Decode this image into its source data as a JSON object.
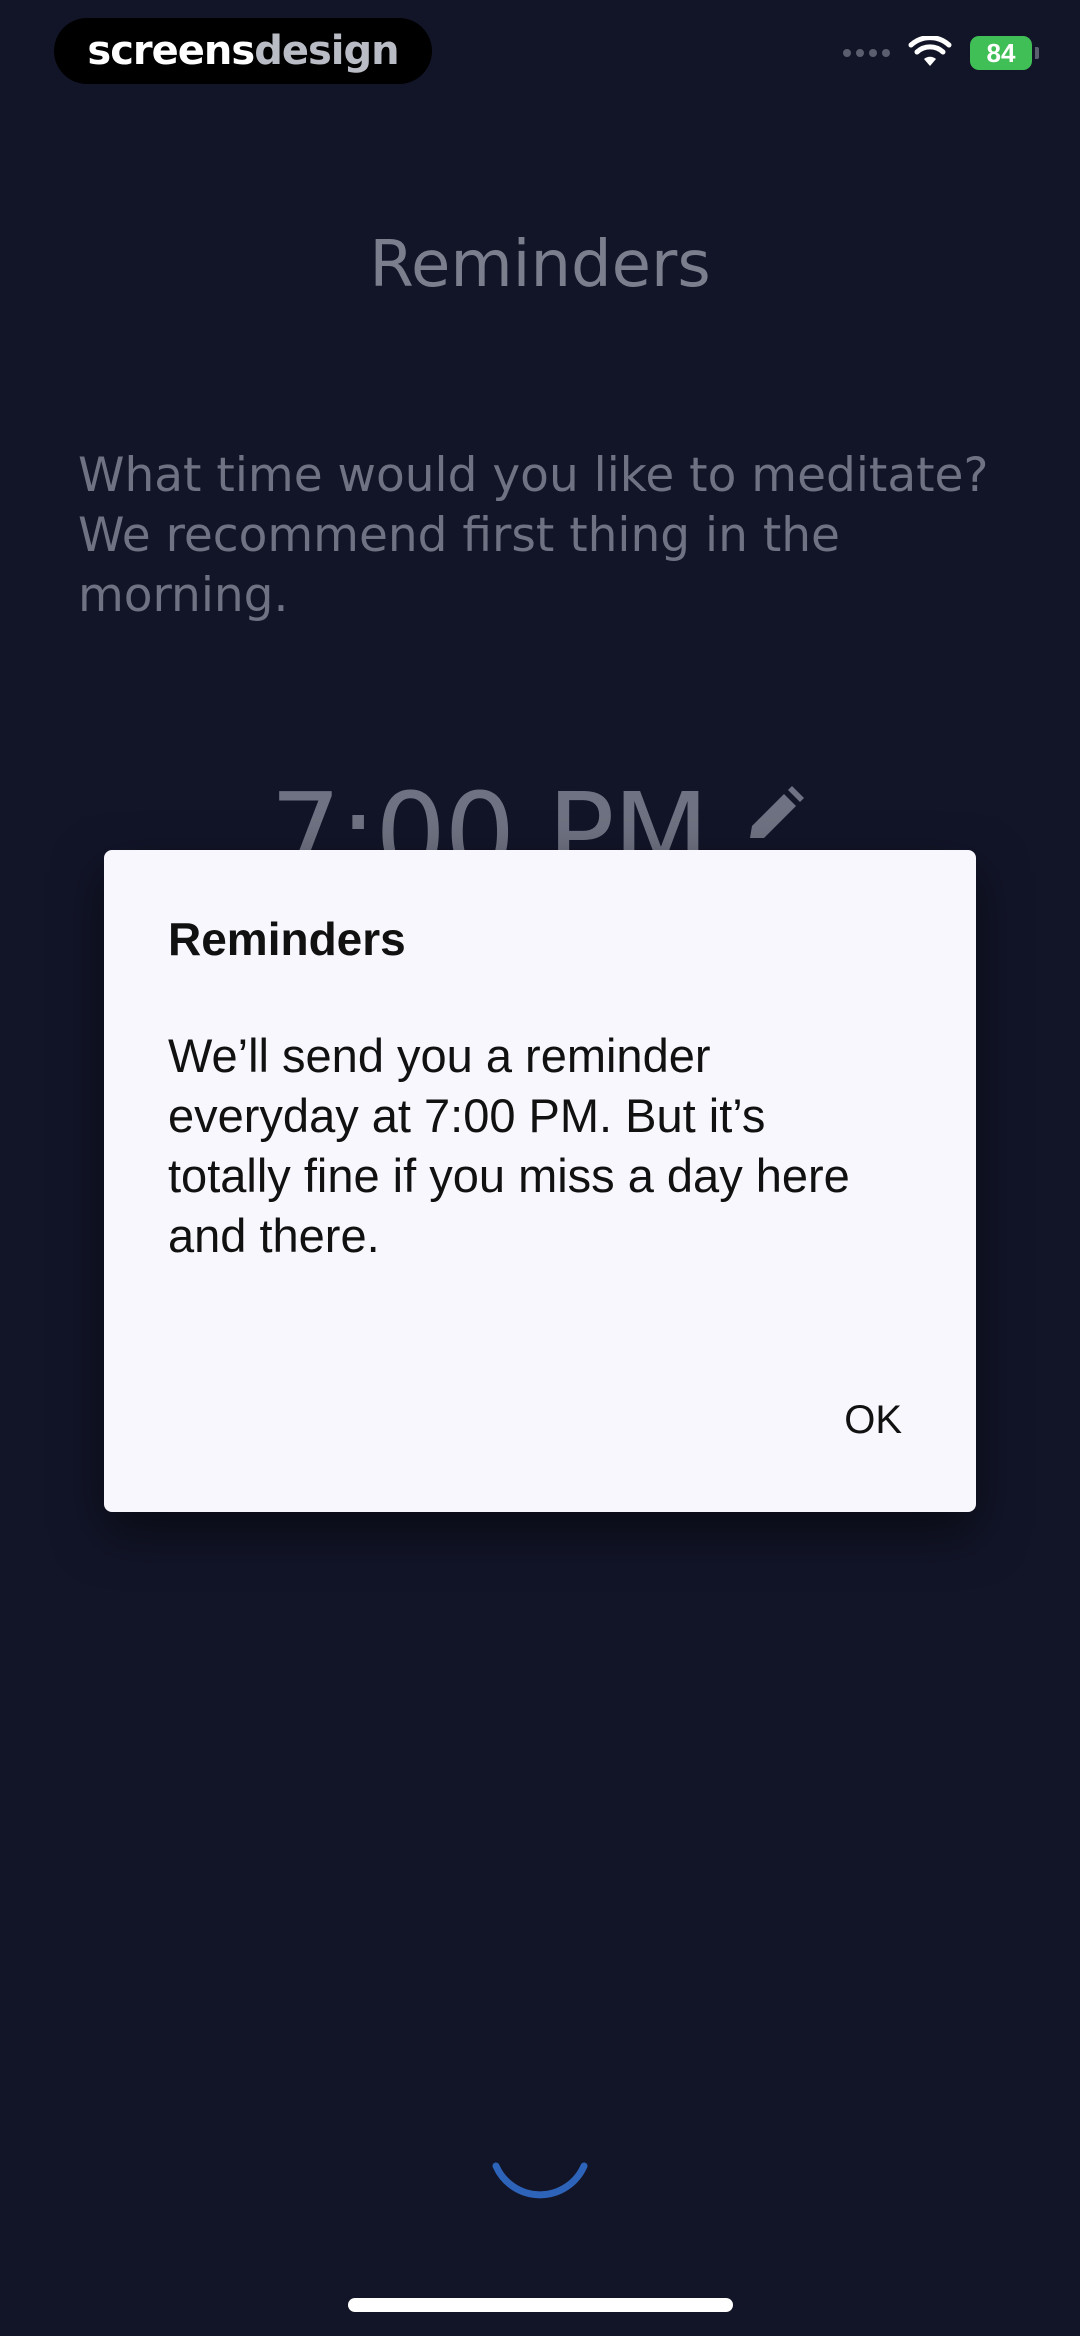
{
  "status_bar": {
    "brand_part1": "screens",
    "brand_part2": "design",
    "battery": "84"
  },
  "screen": {
    "title": "Reminders",
    "description": "What time would you like to meditate? We recommend first thing in the morning.",
    "time": "7:00 PM"
  },
  "dialog": {
    "title": "Reminders",
    "message": "We’ll send you a reminder everyday at 7:00 PM. But it’s totally fine if you miss a day here and there.",
    "ok_label": "OK"
  },
  "colors": {
    "background": "#121528",
    "dialog_bg": "#f8f7fd",
    "loader": "#2d63b8",
    "battery": "#3fbf55"
  },
  "icons": [
    "wifi-icon",
    "battery-icon",
    "edit-pencil-icon",
    "loading-spinner-icon"
  ]
}
